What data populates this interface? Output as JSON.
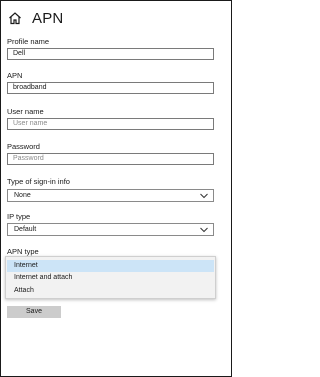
{
  "header": {
    "title": "APN",
    "home_icon": "home-icon"
  },
  "form": {
    "profile_name": {
      "label": "Profile name",
      "value": "Dell"
    },
    "apn": {
      "label": "APN",
      "value": "broadband"
    },
    "user_name": {
      "label": "User name",
      "placeholder": "User name"
    },
    "password": {
      "label": "Password",
      "placeholder": "Password"
    },
    "sign_in_type": {
      "label": "Type of sign-in info",
      "value": "None"
    },
    "ip_type": {
      "label": "IP type",
      "value": "Default"
    },
    "apn_type": {
      "label": "APN type",
      "options": [
        "Internet",
        "Internet and attach",
        "Attach"
      ],
      "selected": "Internet"
    }
  },
  "actions": {
    "save_label": "Save"
  },
  "colors": {
    "dropdown_highlight": "#cce4f7",
    "button_bg": "#cccccc",
    "border": "#7a7a7a"
  }
}
